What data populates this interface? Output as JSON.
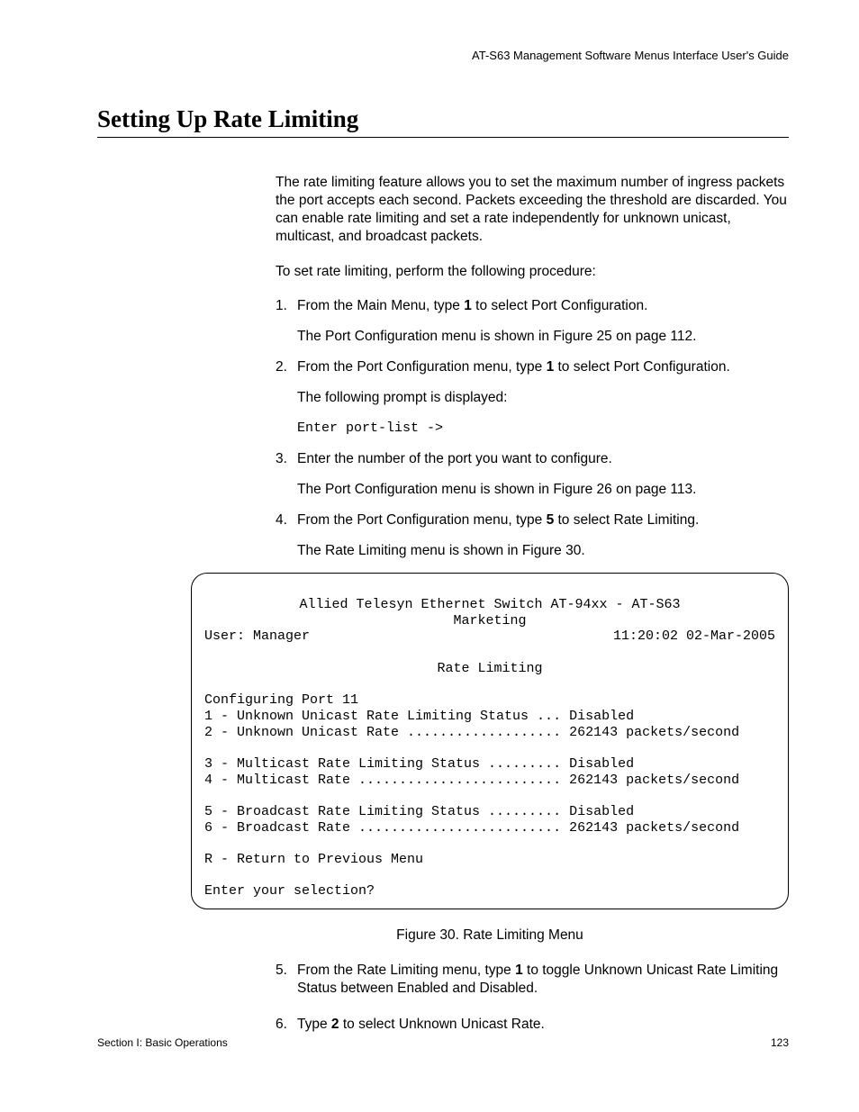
{
  "header": "AT-S63 Management Software Menus Interface User's Guide",
  "title": "Setting Up Rate Limiting",
  "intro": "The rate limiting feature allows you to set the maximum number of ingress packets the port accepts each second. Packets exceeding the threshold are discarded. You can enable rate limiting and set a rate independently for unknown unicast, multicast, and broadcast packets.",
  "lead": "To set rate limiting, perform the following procedure:",
  "steps": {
    "s1_num": "1.",
    "s1_pre": "From the Main Menu, type ",
    "s1_bold": "1",
    "s1_post": " to select Port Configuration.",
    "s1_sub": "The Port Configuration menu is shown in Figure 25 on page 112.",
    "s2_num": "2.",
    "s2_pre": "From the Port Configuration menu, type ",
    "s2_bold": "1",
    "s2_post": " to select Port Configuration.",
    "s2_sub1": "The following prompt is displayed:",
    "s2_prompt": "Enter port-list ->",
    "s3_num": "3.",
    "s3_text": "Enter the number of the port you want to configure.",
    "s3_sub": "The Port Configuration menu is shown in Figure 26 on page 113.",
    "s4_num": "4.",
    "s4_pre": "From the Port Configuration menu, type ",
    "s4_bold": "5",
    "s4_post": " to select Rate Limiting.",
    "s4_sub": "The Rate Limiting menu is shown in Figure 30.",
    "s5_num": "5.",
    "s5_pre": "From the Rate Limiting menu, type ",
    "s5_bold": "1",
    "s5_post": " to toggle Unknown Unicast Rate Limiting Status between Enabled and Disabled.",
    "s6_num": "6.",
    "s6_pre": "Type ",
    "s6_bold": "2",
    "s6_post": " to select Unknown Unicast Rate."
  },
  "terminal": {
    "line1": "Allied Telesyn Ethernet Switch AT-94xx - AT-S63",
    "line2": "Marketing",
    "user": "User: Manager",
    "timestamp": "11:20:02 02-Mar-2005",
    "title": "Rate Limiting",
    "config": "Configuring Port 11",
    "opt1": "1 - Unknown Unicast Rate Limiting Status ... Disabled",
    "opt2": "2 - Unknown Unicast Rate ................... 262143 packets/second",
    "opt3": "3 - Multicast Rate Limiting Status ......... Disabled",
    "opt4": "4 - Multicast Rate ......................... 262143 packets/second",
    "opt5": "5 - Broadcast Rate Limiting Status ......... Disabled",
    "opt6": "6 - Broadcast Rate ......................... 262143 packets/second",
    "optR": "R - Return to Previous Menu",
    "prompt": "Enter your selection?"
  },
  "figure_caption": "Figure 30. Rate Limiting Menu",
  "footer": {
    "section": "Section I: Basic Operations",
    "page": "123"
  }
}
